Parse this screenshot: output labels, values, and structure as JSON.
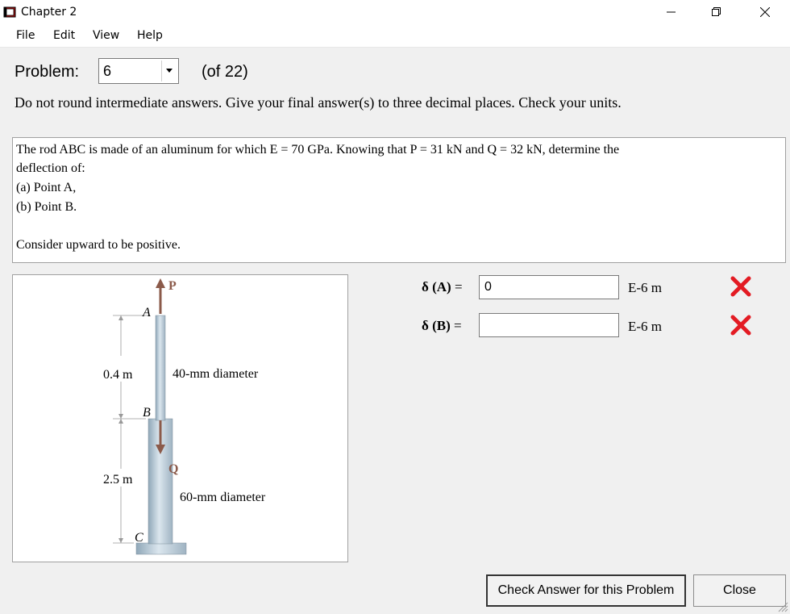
{
  "window": {
    "title": "Chapter 2"
  },
  "menu": [
    {
      "label": "File"
    },
    {
      "label": "Edit"
    },
    {
      "label": "View"
    },
    {
      "label": "Help"
    }
  ],
  "problem": {
    "label": "Problem:",
    "selected": "6",
    "of_text": "(of 22)"
  },
  "instructions": "Do not round intermediate answers.  Give your final answer(s) to three decimal places.  Check your units.",
  "statement": {
    "line1": "The rod ABC is made of an aluminum for which E = 70 GPa. Knowing that P = 31 kN and Q = 32 kN, determine the",
    "line2": "deflection of:",
    "line3": "(a) Point A,",
    "line4": "(b) Point B.",
    "line5": "Consider upward to be positive."
  },
  "figure": {
    "label_P": "P",
    "label_Q": "Q",
    "label_A": "A",
    "label_B": "B",
    "label_C": "C",
    "dim_upper": "0.4 m",
    "dim_lower": "2.5 m",
    "dia_upper": "40-mm diameter",
    "dia_lower": "60-mm diameter"
  },
  "answers": [
    {
      "label": "δ (A)",
      "eq": " =",
      "value": "0",
      "unit": "E-6 m",
      "status_icon": "red-x-icon"
    },
    {
      "label": "δ (B)",
      "eq": " =",
      "value": "",
      "unit": "E-6 m",
      "status_icon": "red-x-icon"
    }
  ],
  "buttons": {
    "check": "Check Answer for this Problem",
    "close": "Close"
  },
  "colors": {
    "error_red": "#e31b23",
    "arrow_brown": "#8b5a4a"
  }
}
